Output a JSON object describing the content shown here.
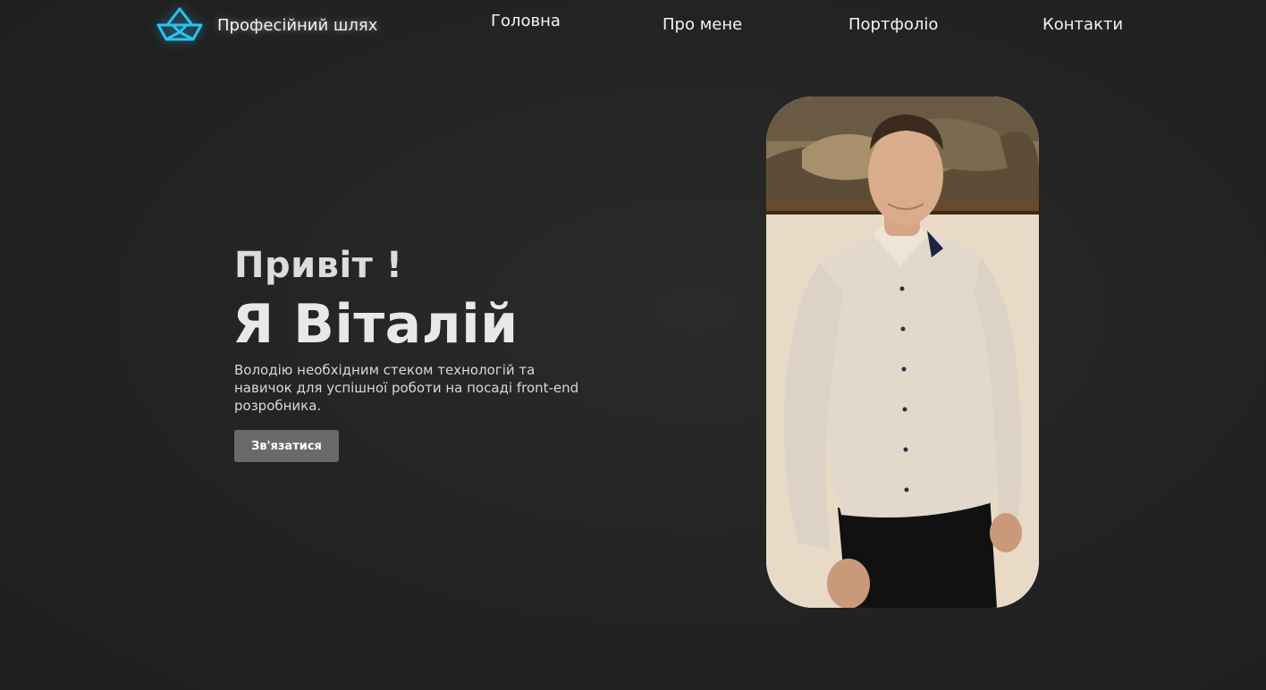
{
  "header": {
    "logo_text": "Професійний шлях",
    "logo_icon": "paper-boat-icon",
    "nav": {
      "home": "Головна",
      "about": "Про мене",
      "portfolio": "Портфоліо",
      "contacts": "Контакти"
    }
  },
  "hero": {
    "greeting": "Привіт !",
    "name": "Я Віталій",
    "description": "Володію необхідним стеком технологій та навичок для успішної роботи на посаді front-end розробника.",
    "cta_label": "Зв'язатися"
  },
  "colors": {
    "background": "#242424",
    "accent": "#29c3f0",
    "button": "#6a6a6a",
    "text": "#e6e6e6"
  }
}
